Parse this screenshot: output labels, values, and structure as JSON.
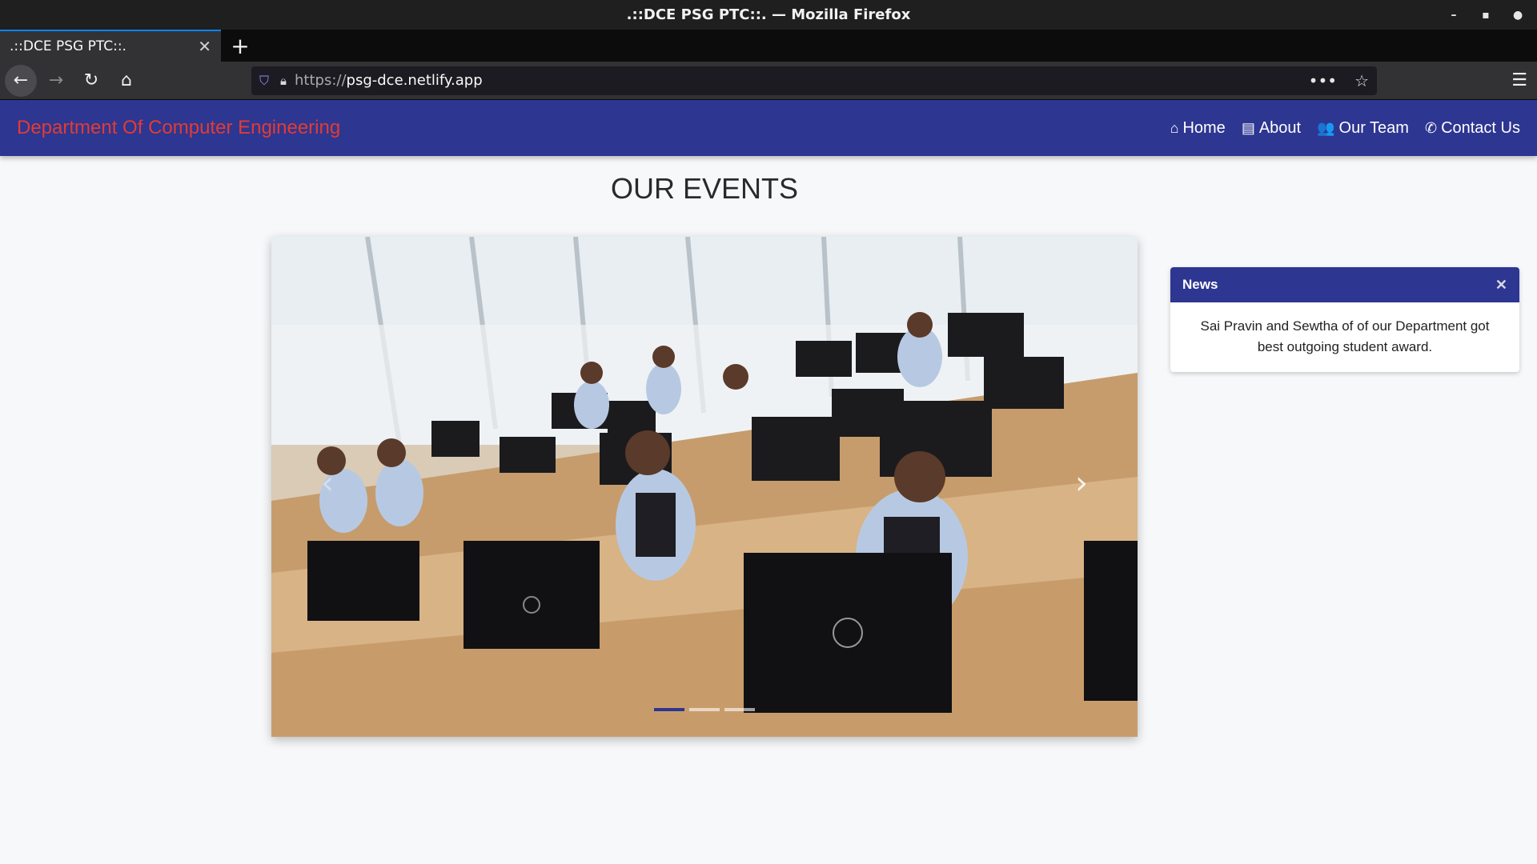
{
  "window": {
    "title": ".::DCE PSG PTC::. — Mozilla Firefox",
    "controls": {
      "minimize": "–",
      "maximize": "▪",
      "close": "●"
    }
  },
  "tabs": [
    {
      "label": ".::DCE PSG PTC::.",
      "close": "✕"
    }
  ],
  "new_tab": "+",
  "nav": {
    "back": "←",
    "forward": "→",
    "reload": "↻",
    "home": "⌂",
    "url_protocol": "https://",
    "url_host": "psg-dce.netlify.app",
    "more": "•••",
    "bookmark": "☆",
    "menu": "☰",
    "icons": {
      "shield": "shield-icon",
      "lock": "lock-icon"
    }
  },
  "site": {
    "brand": "Department Of Computer Engineering",
    "brand_color": "#e33b34",
    "header_color": "#2d3691",
    "nav": [
      {
        "icon": "⌂",
        "icon_name": "home-icon",
        "label": "Home"
      },
      {
        "icon": "▤",
        "icon_name": "newspaper-icon",
        "label": "About"
      },
      {
        "icon": "👥",
        "icon_name": "users-icon",
        "label": "Our Team"
      },
      {
        "icon": "✆",
        "icon_name": "phone-icon",
        "label": "Contact Us"
      }
    ]
  },
  "main": {
    "events_title": "OUR EVENTS",
    "carousel": {
      "slide_count": 3,
      "active_slide": 1,
      "next": "›",
      "prev": "‹"
    },
    "news": {
      "title": "News",
      "close": "✕",
      "body": "Sai Pravin and Sewtha of of our Department got best outgoing student award."
    }
  }
}
